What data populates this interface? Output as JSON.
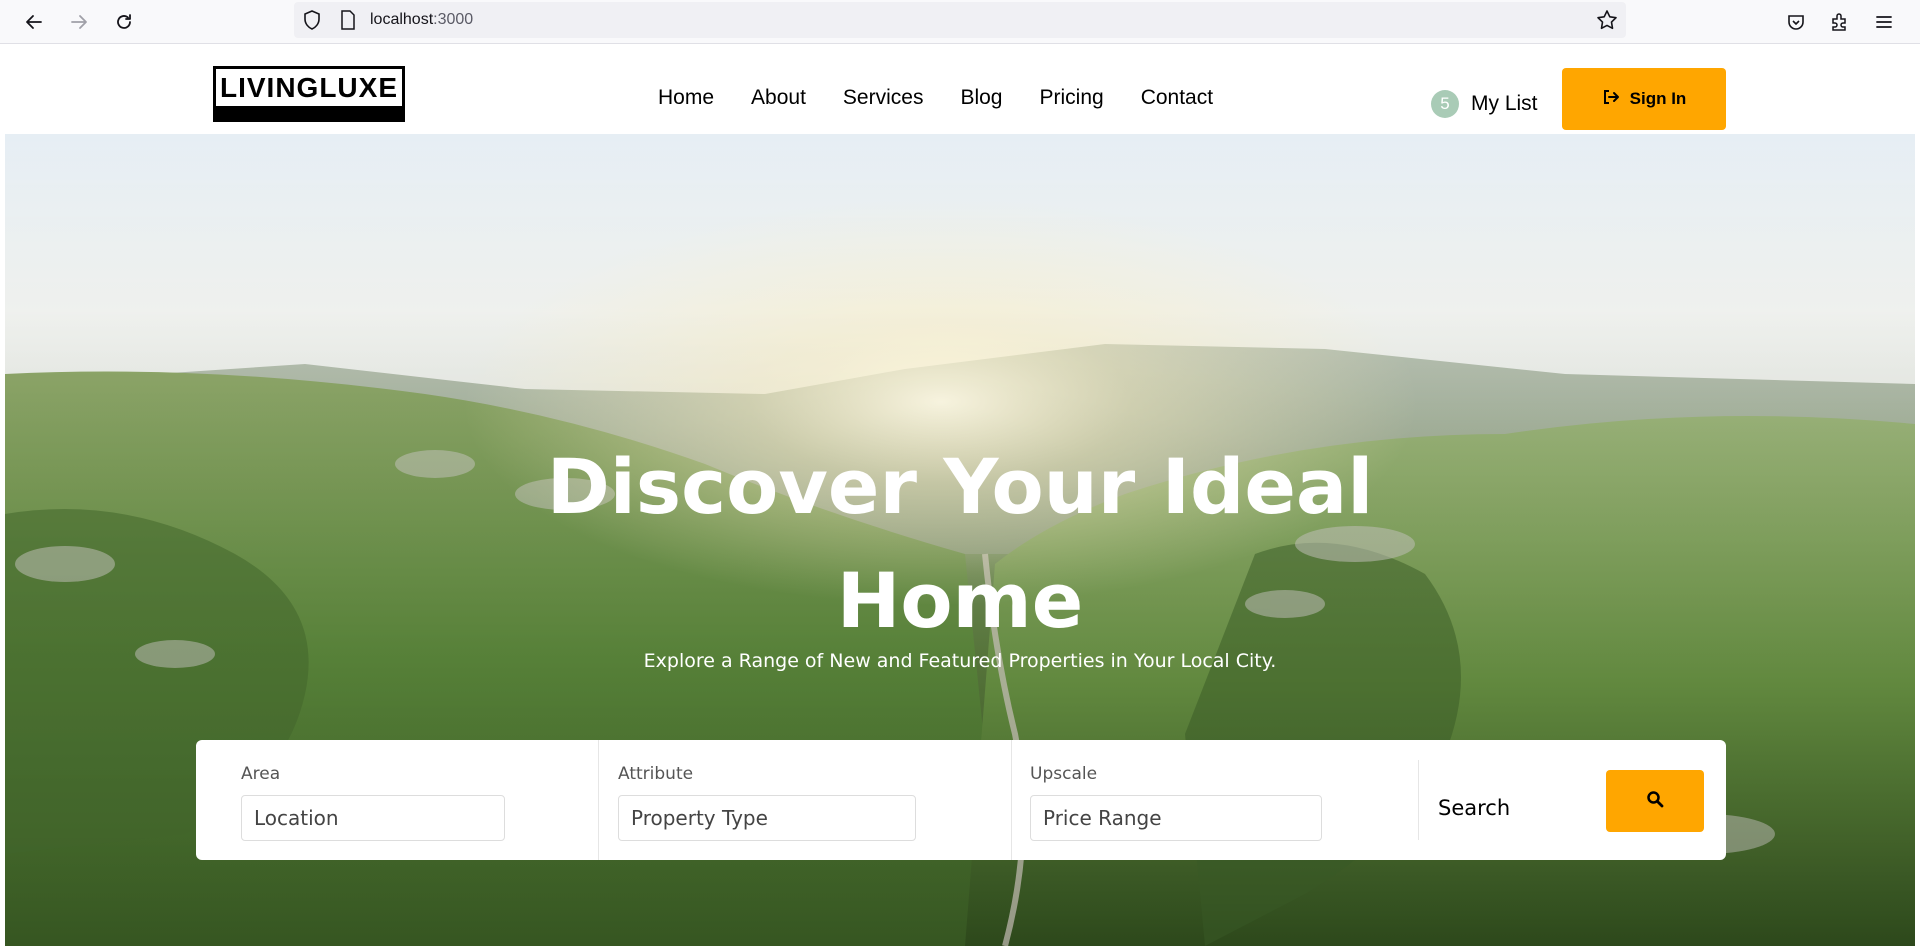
{
  "browser": {
    "url_host": "localhost",
    "url_port": ":3000"
  },
  "header": {
    "logo_text": "LIVINGLUXE",
    "nav": [
      "Home",
      "About",
      "Services",
      "Blog",
      "Pricing",
      "Contact"
    ],
    "mylist_count": "5",
    "mylist_label": "My List",
    "signin_label": "Sign In"
  },
  "hero": {
    "title_line1": "Discover Your Ideal",
    "title_line2": "Home",
    "subtitle": "Explore a Range of New and Featured Properties in Your Local City."
  },
  "search": {
    "area_label": "Area",
    "area_placeholder": "Location",
    "attribute_label": "Attribute",
    "attribute_placeholder": "Property Type",
    "upscale_label": "Upscale",
    "upscale_placeholder": "Price Range",
    "search_label": "Search"
  },
  "colors": {
    "accent": "#ffa600",
    "badge": "#a9cbb6"
  }
}
